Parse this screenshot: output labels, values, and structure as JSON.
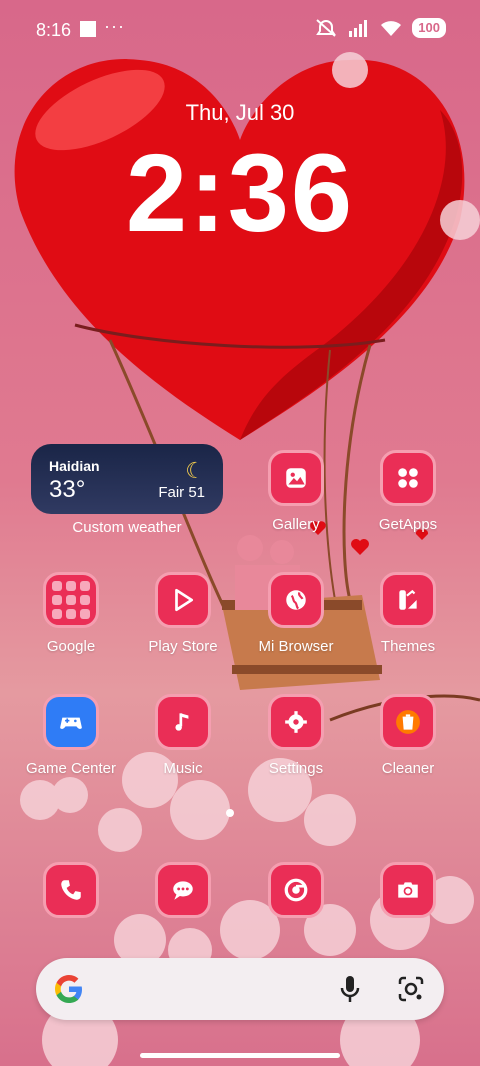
{
  "status_bar": {
    "time": "8:16",
    "dots": "···",
    "battery": "100",
    "icons": [
      "square-icon",
      "more-icon",
      "mute-icon",
      "signal-icon",
      "wifi-icon",
      "battery-icon"
    ]
  },
  "lockclock": {
    "date": "Thu, Jul 30",
    "time": "2:36"
  },
  "weather_widget": {
    "city": "Haidian",
    "temperature": "33°",
    "condition": "Fair 51",
    "icon": "moon-icon",
    "label": "Custom weather"
  },
  "apps": [
    {
      "label": "Gallery",
      "icon": "gallery-icon"
    },
    {
      "label": "GetApps",
      "icon": "getapps-icon"
    },
    {
      "label": "Google",
      "icon": "folder-icon"
    },
    {
      "label": "Play Store",
      "icon": "play-store-icon"
    },
    {
      "label": "Mi Browser",
      "icon": "globe-icon"
    },
    {
      "label": "Themes",
      "icon": "themes-icon"
    },
    {
      "label": "Game Center",
      "icon": "gamepad-icon"
    },
    {
      "label": "Music",
      "icon": "music-icon"
    },
    {
      "label": "Settings",
      "icon": "gear-icon"
    },
    {
      "label": "Cleaner",
      "icon": "trash-icon"
    }
  ],
  "dock": [
    "phone-icon",
    "messages-icon",
    "chrome-icon",
    "camera-icon"
  ],
  "search_bar": {
    "logo": "G",
    "icons": [
      "google-logo",
      "mic-icon",
      "lens-icon"
    ]
  },
  "colors": {
    "icon_bg": "#ea2e56",
    "icon_border": "#f59eb0",
    "background": "#d8688a",
    "widget_bg": "#1a2547"
  }
}
